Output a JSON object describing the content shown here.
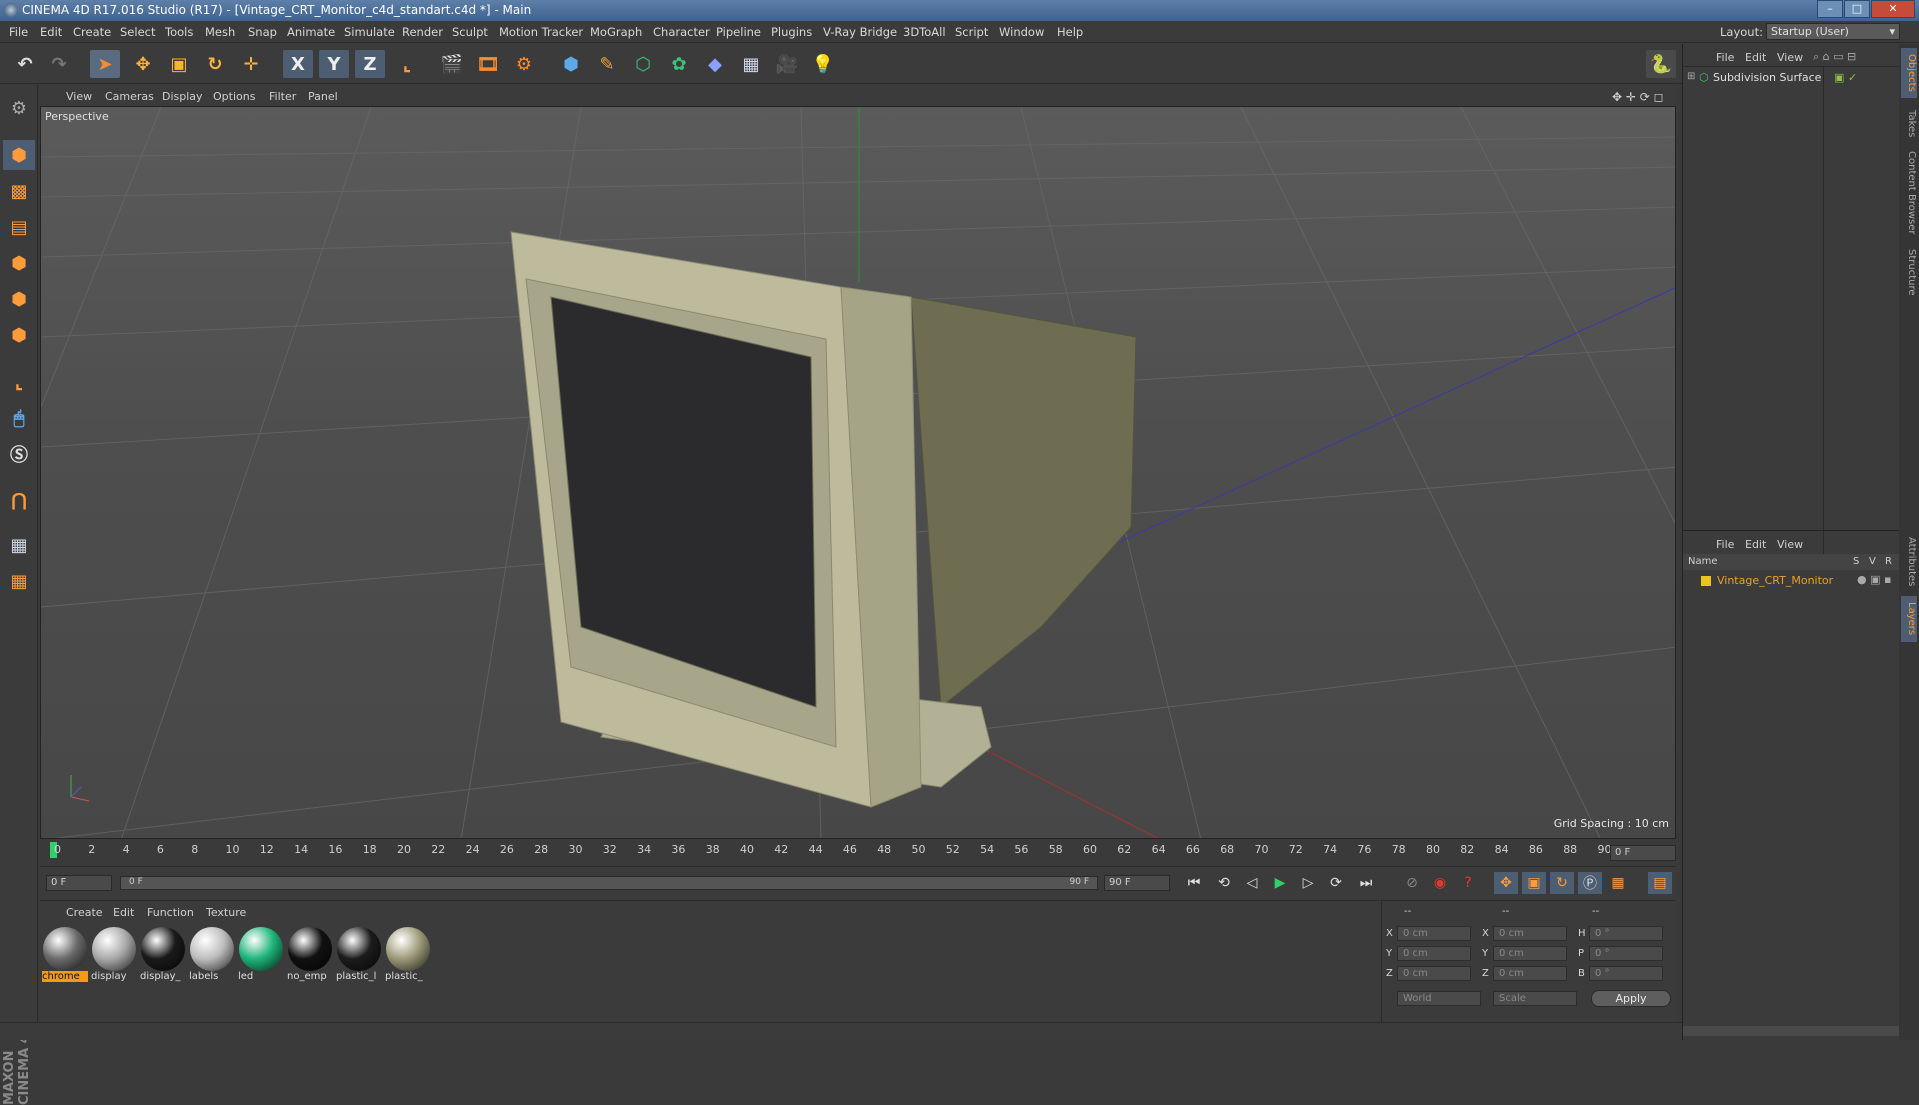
{
  "window": {
    "title": "CINEMA 4D R17.016 Studio (R17) - [Vintage_CRT_Monitor_c4d_standart.c4d *] - Main"
  },
  "menu": [
    "File",
    "Edit",
    "Create",
    "Select",
    "Tools",
    "Mesh",
    "Snap",
    "Animate",
    "Simulate",
    "Render",
    "Sculpt",
    "Motion Tracker",
    "MoGraph",
    "Character",
    "Pipeline",
    "Plugins",
    "V-Ray Bridge",
    "3DToAll",
    "Script",
    "Window",
    "Help"
  ],
  "layout": {
    "label": "Layout:",
    "value": "Startup (User)"
  },
  "toolbar": {
    "axis_x": "X",
    "axis_y": "Y",
    "axis_z": "Z"
  },
  "viewport": {
    "menu": [
      "View",
      "Cameras",
      "Display",
      "Options",
      "Filter",
      "Panel"
    ],
    "label": "Perspective",
    "grid_spacing": "Grid Spacing : 10 cm"
  },
  "timeline": {
    "ticks": [
      "0",
      "2",
      "4",
      "6",
      "8",
      "10",
      "12",
      "14",
      "16",
      "18",
      "20",
      "22",
      "24",
      "26",
      "28",
      "30",
      "32",
      "34",
      "36",
      "38",
      "40",
      "42",
      "44",
      "46",
      "48",
      "50",
      "52",
      "54",
      "56",
      "58",
      "60",
      "62",
      "64",
      "66",
      "68",
      "70",
      "72",
      "74",
      "76",
      "78",
      "80",
      "82",
      "84",
      "86",
      "88",
      "90"
    ],
    "current_frame": "0 F",
    "start": "0 F",
    "range_start": "0 F",
    "range_end": "90 F",
    "end": "90 F"
  },
  "materials": {
    "menu": [
      "Create",
      "Edit",
      "Function",
      "Texture"
    ],
    "items": [
      {
        "name": "chrome",
        "color": "#6a6a6a",
        "selected": true
      },
      {
        "name": "display",
        "color": "#a9a9a9"
      },
      {
        "name": "display_",
        "color": "#1a1a1a"
      },
      {
        "name": "labels",
        "color": "#bdbdbd"
      },
      {
        "name": "led",
        "color": "#1fb47a"
      },
      {
        "name": "no_emp",
        "color": "#111111"
      },
      {
        "name": "plastic_l",
        "color": "#1c1c1c"
      },
      {
        "name": "plastic_",
        "color": "#9c9a78"
      }
    ]
  },
  "coords": {
    "header": [
      "--",
      "--",
      "--"
    ],
    "rows": [
      {
        "l1": "X",
        "v1": "0 cm",
        "l2": "X",
        "v2": "0 cm",
        "l3": "H",
        "v3": "0 °"
      },
      {
        "l1": "Y",
        "v1": "0 cm",
        "l2": "Y",
        "v2": "0 cm",
        "l3": "P",
        "v3": "0 °"
      },
      {
        "l1": "Z",
        "v1": "0 cm",
        "l2": "Z",
        "v2": "0 cm",
        "l3": "B",
        "v3": "0 °"
      }
    ],
    "mode1": "World",
    "mode2": "Scale",
    "apply": "Apply"
  },
  "objects": {
    "menu": [
      "File",
      "Edit",
      "View"
    ],
    "items": [
      {
        "name": "Subdivision Surface"
      }
    ]
  },
  "layers": {
    "menu": [
      "File",
      "Edit",
      "View"
    ],
    "columns": [
      "Name",
      "S",
      "V",
      "R"
    ],
    "items": [
      {
        "name": "Vintage_CRT_Monitor"
      }
    ]
  },
  "side_tabs": [
    "Objects",
    "Takes",
    "Content Browser",
    "Structure",
    "Attributes",
    "Layers"
  ],
  "brand": "MAXON CINEMA 4D"
}
